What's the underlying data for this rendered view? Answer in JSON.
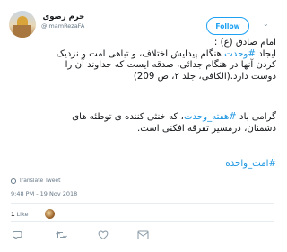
{
  "user": {
    "display_name": "حرم رضوی",
    "handle": "@ImamRezaFA"
  },
  "follow_label": "Follow",
  "tweet": {
    "lines": [
      {
        "text": "امام صادق (ع) :"
      },
      {
        "before": "ایجاد ",
        "hashtag": "#وحدت",
        "after": " هنگام پیدایش اختلاف، و تباهی امت و نزدیک"
      },
      {
        "text": "کردن آنها در هنگام جدائی، صدقه ایست که خداوند آن را"
      },
      {
        "text": "دوست دارد.(الکافی، جلد ۲، ص 209)"
      },
      {
        "before": "گرامی باد ",
        "hashtag": "#هفته_وحدت",
        "after": "، که خنثی کننده ی توطئه های"
      },
      {
        "text": "دشمنان، درمسیر تفرقه افکنی است."
      },
      {
        "hashtag": "#امت_واحده"
      }
    ]
  },
  "translate_label": "Translate Tweet",
  "timestamp": "9:48 PM - 19 Nov 2018",
  "likes": {
    "count": "1",
    "label": "Like"
  },
  "icons": {
    "reply": "reply-icon",
    "retweet": "retweet-icon",
    "like": "heart-icon",
    "dm": "envelope-icon",
    "translate": "globe-icon",
    "more": "chevron-down-icon"
  },
  "colors": {
    "accent": "#1da1f2",
    "hashtag": "#1b95e0",
    "muted": "#657786"
  }
}
